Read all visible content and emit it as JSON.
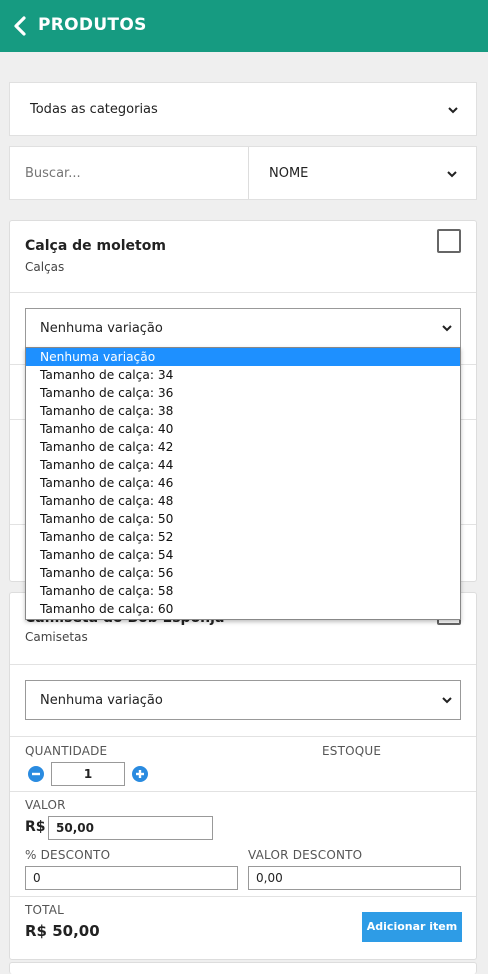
{
  "header": {
    "title": "PRODUTOS"
  },
  "filters": {
    "category": "Todas as categorias",
    "search_placeholder": "Buscar...",
    "sort": "NOME"
  },
  "products": [
    {
      "name": "Calça de moletom",
      "category": "Calças",
      "variation": "Nenhuma variação"
    },
    {
      "name": "Camiseta do Bob Esponja",
      "category": "Camisetas",
      "variation": "Nenhuma variação",
      "quantity_label": "QUANTIDADE",
      "stock_label": "ESTOQUE",
      "quantity": "1",
      "price_label": "VALOR",
      "currency": "R$",
      "price": "50,00",
      "discount_pct_label": "% DESCONTO",
      "discount_pct": "0",
      "discount_value_label": "VALOR DESCONTO",
      "discount_value": "0,00",
      "total_label": "TOTAL",
      "total": "R$ 50,00",
      "add_button": "Adicionar item"
    }
  ],
  "dropdown": {
    "options": [
      "Nenhuma variação",
      "Tamanho de calça: 34",
      "Tamanho de calça: 36",
      "Tamanho de calça: 38",
      "Tamanho de calça: 40",
      "Tamanho de calça: 42",
      "Tamanho de calça: 44",
      "Tamanho de calça: 46",
      "Tamanho de calça: 48",
      "Tamanho de calça: 50",
      "Tamanho de calça: 52",
      "Tamanho de calça: 54",
      "Tamanho de calça: 56",
      "Tamanho de calça: 58",
      "Tamanho de calça: 60"
    ],
    "selected": "Nenhuma variação"
  },
  "colors": {
    "header": "#169b81",
    "accent": "#2e9ce6",
    "highlight": "#1e90ff"
  }
}
